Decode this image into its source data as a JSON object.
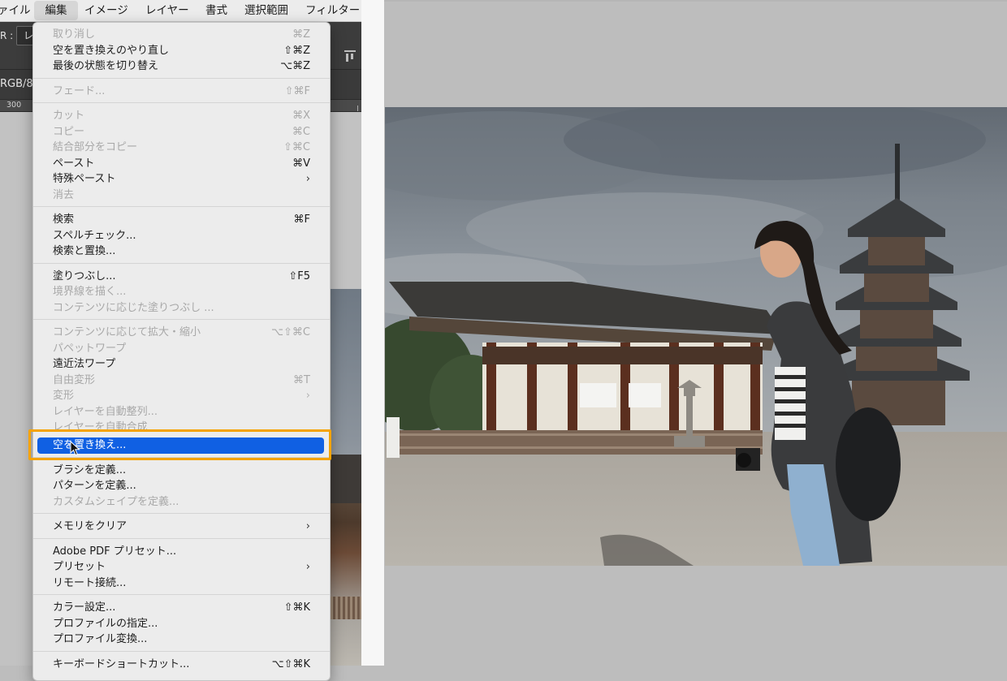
{
  "menubar": {
    "items": [
      {
        "label": "ァイル",
        "active": false
      },
      {
        "label": "編集",
        "active": true
      },
      {
        "label": "イメージ",
        "active": false
      },
      {
        "label": "レイヤー",
        "active": false
      },
      {
        "label": "書式",
        "active": false
      },
      {
        "label": "選択範囲",
        "active": false
      },
      {
        "label": "フィルター",
        "active": false
      }
    ]
  },
  "options_bar": {
    "label": "R :",
    "field_value": "レ"
  },
  "doc_tab": {
    "label": "RGB/8"
  },
  "ruler": {
    "label": "300"
  },
  "edit_menu": {
    "groups": [
      [
        {
          "label": "取り消し",
          "shortcut": "⌘Z",
          "enabled": false
        },
        {
          "label": "空を置き換えのやり直し",
          "shortcut": "⇧⌘Z",
          "enabled": true
        },
        {
          "label": "最後の状態を切り替え",
          "shortcut": "⌥⌘Z",
          "enabled": true
        }
      ],
      [
        {
          "label": "フェード...",
          "shortcut": "⇧⌘F",
          "enabled": false
        }
      ],
      [
        {
          "label": "カット",
          "shortcut": "⌘X",
          "enabled": false
        },
        {
          "label": "コピー",
          "shortcut": "⌘C",
          "enabled": false
        },
        {
          "label": "結合部分をコピー",
          "shortcut": "⇧⌘C",
          "enabled": false
        },
        {
          "label": "ペースト",
          "shortcut": "⌘V",
          "enabled": true
        },
        {
          "label": "特殊ペースト",
          "submenu": true,
          "enabled": true
        },
        {
          "label": "消去",
          "enabled": false
        }
      ],
      [
        {
          "label": "検索",
          "shortcut": "⌘F",
          "enabled": true
        },
        {
          "label": "スペルチェック...",
          "enabled": true
        },
        {
          "label": "検索と置換...",
          "enabled": true
        }
      ],
      [
        {
          "label": "塗りつぶし...",
          "shortcut": "⇧F5",
          "enabled": true
        },
        {
          "label": "境界線を描く...",
          "enabled": false
        },
        {
          "label": "コンテンツに応じた塗りつぶし ...",
          "enabled": false
        }
      ],
      [
        {
          "label": "コンテンツに応じて拡大・縮小",
          "shortcut": "⌥⇧⌘C",
          "enabled": false
        },
        {
          "label": "パペットワープ",
          "enabled": false
        },
        {
          "label": "遠近法ワープ",
          "enabled": true
        },
        {
          "label": "自由変形",
          "shortcut": "⌘T",
          "enabled": false
        },
        {
          "label": "変形",
          "submenu": true,
          "enabled": false
        },
        {
          "label": "レイヤーを自動整列...",
          "enabled": false
        },
        {
          "label": "レイヤーを自動合成",
          "enabled": false
        }
      ],
      [
        {
          "label": "ブラシを定義...",
          "enabled": true
        },
        {
          "label": "パターンを定義...",
          "enabled": true
        },
        {
          "label": "カスタムシェイプを定義...",
          "enabled": false
        }
      ],
      [
        {
          "label": "メモリをクリア",
          "submenu": true,
          "enabled": true
        }
      ],
      [
        {
          "label": "Adobe PDF プリセット...",
          "enabled": true
        },
        {
          "label": "プリセット",
          "submenu": true,
          "enabled": true
        },
        {
          "label": "リモート接続...",
          "enabled": true
        }
      ],
      [
        {
          "label": "カラー設定...",
          "shortcut": "⇧⌘K",
          "enabled": true
        },
        {
          "label": "プロファイルの指定...",
          "enabled": true
        },
        {
          "label": "プロファイル変換...",
          "enabled": true
        }
      ],
      [
        {
          "label": "キーボードショートカット...",
          "shortcut": "⌥⇧⌘K",
          "enabled": true
        }
      ]
    ],
    "highlighted": {
      "label": "空を置き換え..."
    }
  },
  "colors": {
    "highlight": "#1060e3",
    "callout": "#f5a300",
    "menu_bg": "#ececec",
    "disabled_text": "#a8a8a8"
  }
}
